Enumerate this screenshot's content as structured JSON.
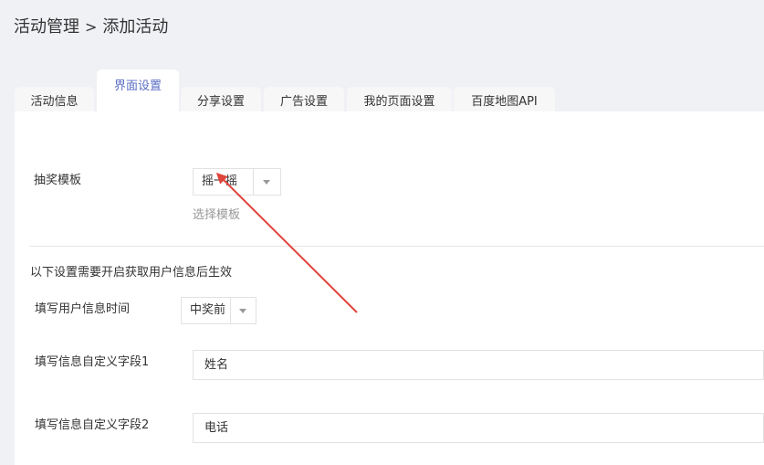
{
  "breadcrumb": {
    "parent": "活动管理",
    "separator": ">",
    "current": "添加活动"
  },
  "tabs": [
    {
      "label": "活动信息"
    },
    {
      "label": "界面设置"
    },
    {
      "label": "分享设置"
    },
    {
      "label": "广告设置"
    },
    {
      "label": "我的页面设置"
    },
    {
      "label": "百度地图API"
    }
  ],
  "form": {
    "lottery_template": {
      "label": "抽奖模板",
      "value": "摇一摇",
      "help": "选择模板"
    },
    "note": "以下设置需要开启获取用户信息后生效",
    "fill_time": {
      "label": "填写用户信息时间",
      "value": "中奖前"
    },
    "custom_field_1": {
      "label": "填写信息自定义字段1",
      "value": "姓名"
    },
    "custom_field_2": {
      "label": "填写信息自定义字段2",
      "value": "电话"
    }
  },
  "colors": {
    "active_tab": "#5a6ec5",
    "annotation_arrow": "#e0443a",
    "page_bg": "#f0f1f5"
  }
}
